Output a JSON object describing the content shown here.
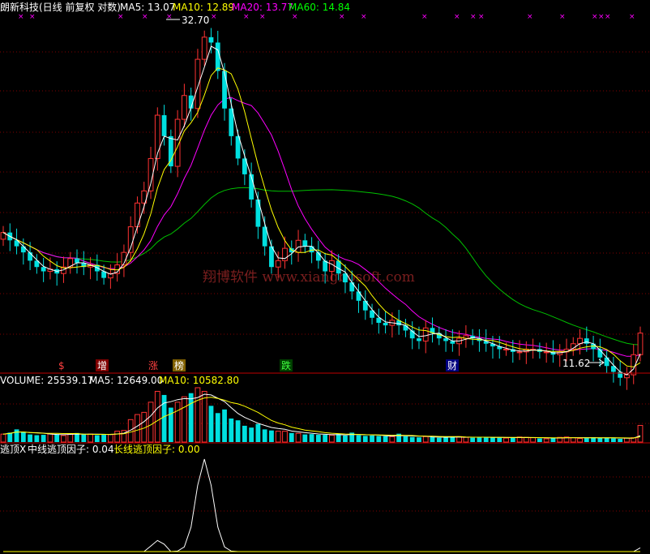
{
  "header": {
    "title": "朗新科技(日线 前复权 对数)",
    "ma5": "MA5: 13.07",
    "ma10": "MA10: 12.89",
    "ma20": "MA20: 13.77",
    "ma60": "MA60: 14.84"
  },
  "volume_header": {
    "label": "VOLUME: 25539.17",
    "ma5": "MA5: 12649.00",
    "ma10": "MA10: 10582.80"
  },
  "indicator_header": {
    "name": "逃顶X",
    "mid": "中线逃顶因子: 0.04",
    "long": "长线逃顶因子: 0.00"
  },
  "annotations": {
    "high": "32.70",
    "low": "11.62",
    "watermark": "翔博软件 www.xiangbosoft.com"
  },
  "event_tags": [
    {
      "text": "$",
      "color": "#ff4040"
    },
    {
      "text": "增",
      "color": "#ffffff",
      "bg": "#800000"
    },
    {
      "text": "涨",
      "color": "#ff4040"
    },
    {
      "text": "榜",
      "color": "#ffffff",
      "bg": "#806000"
    },
    {
      "text": "跌",
      "color": "#40ff40",
      "bg": "#004000"
    },
    {
      "text": "财",
      "color": "#ffffff",
      "bg": "#000080"
    }
  ],
  "colors": {
    "up": "#ff3232",
    "down": "#00e0e0",
    "ma5": "#ffffff",
    "ma10": "#ffff00",
    "ma20": "#ff00ff",
    "ma60": "#00c000",
    "grid": "#800000",
    "divider": "#c00000"
  },
  "chart_data": {
    "type": "candlestick",
    "price_scale": "log",
    "price_range": [
      11.62,
      32.7
    ],
    "closes": [
      17.2,
      16.8,
      16.5,
      16.2,
      15.8,
      15.5,
      15.3,
      15.4,
      15.2,
      15.5,
      15.9,
      15.7,
      15.5,
      15.6,
      15.3,
      15.0,
      15.2,
      15.6,
      16.2,
      17.5,
      18.8,
      19.5,
      21.5,
      24.5,
      23.0,
      21.0,
      24.2,
      26.0,
      25.0,
      29.0,
      31.0,
      30.5,
      28.0,
      25.0,
      23.0,
      21.5,
      20.5,
      19.0,
      17.5,
      16.5,
      15.5,
      15.8,
      16.4,
      16.2,
      16.8,
      16.5,
      16.2,
      15.8,
      15.3,
      15.8,
      15.2,
      14.8,
      14.4,
      14.0,
      13.6,
      13.3,
      13.1,
      13.0,
      13.2,
      13.0,
      12.8,
      12.5,
      12.4,
      12.9,
      12.7,
      12.5,
      12.4,
      12.3,
      12.5,
      12.6,
      12.5,
      12.4,
      12.3,
      12.2,
      12.1,
      12.1,
      12.0,
      12.0,
      12.1,
      12.1,
      12.0,
      12.0,
      11.9,
      12.0,
      12.1,
      12.3,
      12.5,
      12.3,
      12.1,
      11.8,
      11.5,
      11.3,
      11.1,
      11.2,
      11.9,
      12.7
    ],
    "volume": [
      2200,
      2600,
      3500,
      2800,
      2100,
      1900,
      2000,
      2300,
      2200,
      1800,
      2300,
      2500,
      2100,
      2200,
      1900,
      2000,
      2100,
      3000,
      3200,
      6200,
      7600,
      8200,
      11000,
      14000,
      13000,
      9500,
      11000,
      12500,
      13500,
      15000,
      14000,
      10000,
      8000,
      9000,
      6500,
      6000,
      4500,
      4000,
      5000,
      3500,
      3200,
      3000,
      3000,
      2500,
      2400,
      2100,
      2200,
      2000,
      2000,
      1900,
      2200,
      1800,
      2600,
      1900,
      1700,
      1800,
      1700,
      1600,
      1500,
      2300,
      1600,
      1400,
      1300,
      1500,
      1400,
      1200,
      1300,
      1400,
      1500,
      1300,
      1200,
      1300,
      1400,
      1300,
      1200,
      1100,
      1200,
      1400,
      1300,
      1200,
      1000,
      900,
      1200,
      1300,
      1400,
      1200,
      1000,
      1100,
      1300,
      1200,
      1200,
      1000,
      900,
      1100,
      1200,
      4600
    ],
    "indicator_mid_peak": 1.0,
    "indicator_mid_last": 0.04,
    "indicator_long_last": 0.0
  }
}
